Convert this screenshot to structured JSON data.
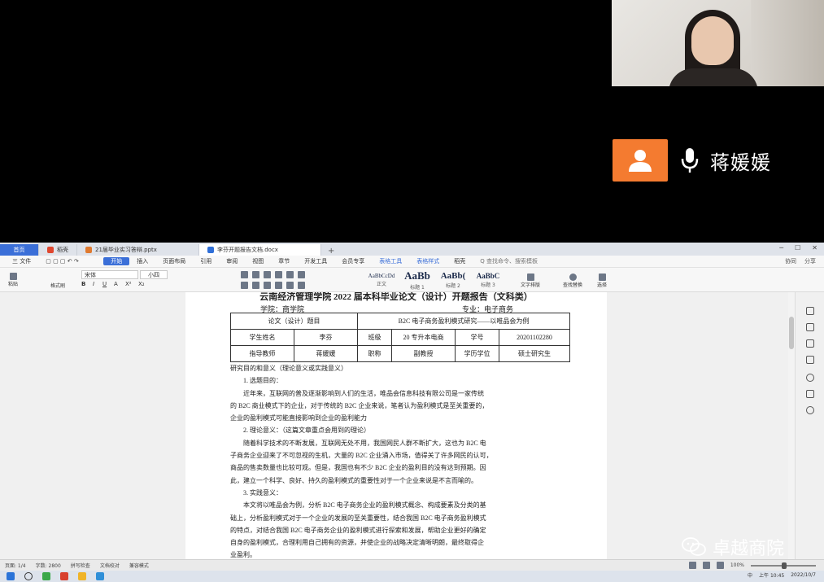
{
  "presenter": {
    "name": "蒋媛媛"
  },
  "tabs": [
    {
      "label": "首页",
      "kind": "home",
      "color": "#3b6fd8"
    },
    {
      "label": "稻壳",
      "kind": "normal",
      "color": "#e0472f"
    },
    {
      "label": "21届毕业实习答辩.pptx",
      "kind": "normal",
      "color": "#e07a2f"
    },
    {
      "label": "李芬开题报告文档.docx",
      "kind": "active",
      "color": "#2f6fd8"
    }
  ],
  "menu": [
    "三 文件",
    "开始",
    "插入",
    "页面布局",
    "引用",
    "审阅",
    "视图",
    "章节",
    "开发工具",
    "会员专享",
    "表格工具",
    "表格样式",
    "稻壳"
  ],
  "menu_search": "Q 查找命令、搜索模板",
  "menu_right": [
    "协同",
    "分享"
  ],
  "ribbon": {
    "paste": "粘贴",
    "format_painter": "格式刷",
    "font": "宋体",
    "font_size": "小四",
    "styles": [
      {
        "sample": "AaBbCcDd",
        "label": "正文"
      },
      {
        "sample": "AaBb",
        "label": "标题 1"
      },
      {
        "sample": "AaBb(",
        "label": "标题 2"
      },
      {
        "sample": "AaBbC",
        "label": "标题 3"
      }
    ],
    "text_layout": "文字排版",
    "find_replace": "查找替换",
    "select": "选择"
  },
  "document": {
    "title": "云南经济管理学院 2022 届本科毕业论文（设计）开题报告（文科类）",
    "school_label": "学院：商学院",
    "major_label": "专业：电子商务",
    "table": {
      "thesis_label": "论文（设计）题目",
      "thesis_value": "B2C 电子商务盈利模式研究——以唯品会为例",
      "student_label": "学生姓名",
      "student_value": "李芬",
      "class_label": "班级",
      "class_value": "20 专升本电商",
      "id_label": "学号",
      "id_value": "20201102280",
      "advisor_label": "指导教师",
      "advisor_value": "蒋媛媛",
      "title_label": "职称",
      "title_value": "副教授",
      "degree_label": "学历学位",
      "degree_value": "硕士研究生"
    },
    "lines": [
      "研究目的和意义（理论意义或实践意义）",
      "1. 选题目的：",
      "近年来，互联网的普及逐渐影响到人们的生活，唯品会信息科技有限公司是一家传统",
      "的 B2C 商业模式下的企业，对于传统的 B2C 企业来说，笔者认为盈利模式是至关重要的，",
      "企业的盈利模式可能直接影响到企业的盈利能力",
      "2. 理论意义：（这篇文章重点会用到的理论）",
      "随着科学技术的不断发展，互联网无处不用，我国网民人群不断扩大，这也为 B2C 电",
      "子商务企业迎来了不可忽视的生机，大量的 B2C 企业涌入市场，值得关了许多网民的认可，",
      "商品的售卖数量也比较可观。但是，我国也有不少 B2C 企业的盈利目的没有达到预期。因",
      "此，建立一个科学、良好、持久的盈利模式的重要性对于一个企业来说是不言而喻的。",
      "3. 实践意义：",
      "本文将以唯品会为例，分析 B2C 电子商务企业的盈利模式概念、构成要素及分类的基",
      "础上，分析盈利模式对于一个企业的发展的至关重要性，结合我国 B2C 电子商务盈利模式",
      "的特点，对结合我国 B2C 电子商务企业的盈利模式进行探索和发展，帮助企业更好的确定",
      "自身的盈利模式，合理利用自己拥有的资源，并使企业的战略决定清晰明朗，最终取得企",
      "业盈利。"
    ]
  },
  "status": {
    "page": "页面: 1/4",
    "words": "字数: 2800",
    "spell": "拼写检查",
    "doc_check": "文档校对",
    "compat": "兼容模式",
    "zoom": "100%"
  },
  "taskbar": {
    "time": "上午 10:45",
    "date": "2022/10/7",
    "lang": "中"
  },
  "watermark": {
    "text": "卓越商院"
  },
  "colors": {
    "accent_orange": "#f47b30",
    "wps_blue": "#3b6fd8"
  }
}
